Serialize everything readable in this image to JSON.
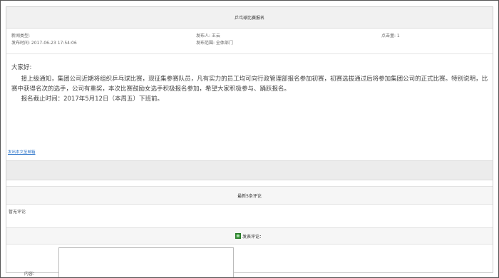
{
  "notice": {
    "title": "乒乓球比赛报名",
    "meta": {
      "type_label": "新闻类型:",
      "publish_time": "发布时间: 2017-06-23 17:54:06",
      "publisher": "发布人: 王云",
      "scope": "发布范围: 全体部门",
      "clicks": "点击量: 1"
    },
    "body": {
      "greeting": "大家好:",
      "para1": "接上级通知，集团公司近期将组织乒乓球比赛，现征集参赛队员，凡有实力的员工均可向行政管理部报名参加初赛，初赛选拔通过后将参加集团公司的正式比赛。特别说明，比赛中获得名次的选手，公司有重奖，本次比赛鼓励女选手积极报名参加，希望大家积极参与、踊跃报名。",
      "para2": "报名截止时间：2017年5月12日（本周五）下班前。"
    },
    "send_link": "发出本文至邮箱"
  },
  "comments": {
    "header": "最新5条评论",
    "empty_text": "暂无评论",
    "post_label": "发表评论：",
    "content_label": "内容："
  },
  "icons": {
    "post": "add-comment-icon"
  },
  "colors": {
    "link": "#2a73c9",
    "icon_green": "#3a9a3a"
  }
}
